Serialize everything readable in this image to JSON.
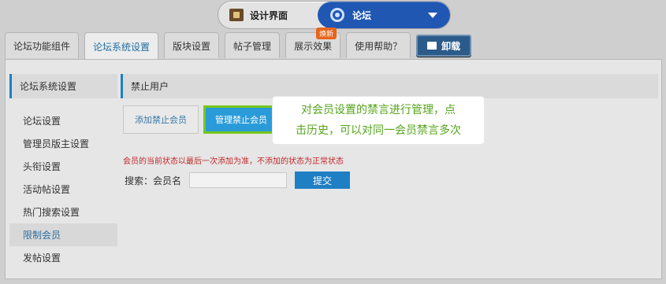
{
  "switcher": {
    "left_label": "设计界面",
    "right_label": "论坛"
  },
  "tabs": [
    {
      "label": "论坛功能组件"
    },
    {
      "label": "论坛系统设置"
    },
    {
      "label": "版块设置"
    },
    {
      "label": "帖子管理"
    },
    {
      "label": "展示效果",
      "badge": "焕新"
    },
    {
      "label": "使用帮助？"
    }
  ],
  "unload_label": "卸载",
  "sidebar": {
    "title": "论坛系统设置",
    "items": [
      {
        "label": "论坛设置"
      },
      {
        "label": "管理员版主设置"
      },
      {
        "label": "头衔设置"
      },
      {
        "label": "活动帖设置"
      },
      {
        "label": "热门搜索设置"
      },
      {
        "label": "限制会员"
      },
      {
        "label": "发帖设置"
      }
    ]
  },
  "content": {
    "title": "禁止用户",
    "subtabs": [
      {
        "label": "添加禁止会员"
      },
      {
        "label": "管理禁止会员"
      }
    ],
    "warning": "会员的当前状态以最后一次添加为准，不添加的状态为正常状态",
    "search": {
      "label": "搜索：会员名",
      "value": "",
      "submit_label": "提交"
    }
  },
  "tooltip": {
    "line1": "对会员设置的禁言进行管理，点",
    "line2": "击历史，可以对同一会员禁言多次"
  },
  "colors": {
    "accent": "#1e7fc5",
    "highlight_border": "#76c81a",
    "tooltip_text": "#55a51b",
    "warning_text": "#c0282a"
  }
}
